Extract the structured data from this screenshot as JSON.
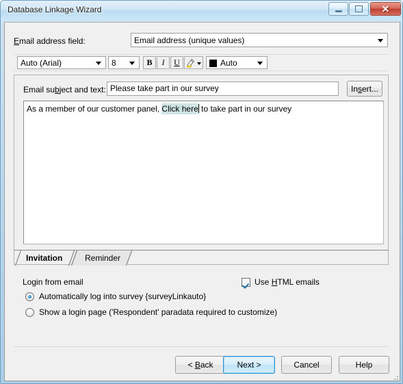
{
  "window": {
    "title": "Database Linkage Wizard",
    "buttons": {
      "minimize": "minimize",
      "maximize": "restore",
      "close": "✕"
    }
  },
  "email_field_row": {
    "label_pre": "E",
    "label_post": "mail address field:",
    "label_full": "Email address field:",
    "combo_value": "Email address (unique values)"
  },
  "toolbar": {
    "font_value": "Auto (Arial)",
    "size_value": "8",
    "bold_label": "B",
    "italic_label": "I",
    "underline_label": "U",
    "highlight_label": "highlight",
    "color_value": "Auto",
    "color_swatch": "#000000"
  },
  "subject_row": {
    "label_pre": "Email su",
    "label_accel": "b",
    "label_post": "ject and text:",
    "label_full": "Email subject and text:",
    "input_value": "Please take part in our survey",
    "insert_pre": "In",
    "insert_accel": "s",
    "insert_post": "ert...",
    "insert_label": "Insert..."
  },
  "body_editor": {
    "text_before": "As a member of our customer panel, ",
    "text_selected": "Click here",
    "text_after": " to take part in our survey",
    "full_text": "As a member of our customer panel, Click here to take part in our survey",
    "selection_color": "#cfe5e5"
  },
  "tabs": [
    {
      "label": "Invitation",
      "active": true
    },
    {
      "label": "Reminder",
      "active": false
    }
  ],
  "login_group": {
    "label": "Login from email",
    "options": [
      {
        "label": "Automatically log into survey {surveyLinkauto}",
        "selected": true
      },
      {
        "label": "Show a login page ('Respondent' paradata required to customize)",
        "selected": false
      }
    ]
  },
  "html_checkbox": {
    "pre": "Use ",
    "accel": "H",
    "post": "TML emails",
    "label": "Use HTML emails",
    "checked": true
  },
  "footer": {
    "back_pre": "< ",
    "back_accel": "B",
    "back_post": "ack",
    "back_label": "< Back",
    "next_label": "Next >",
    "cancel_label": "Cancel",
    "help_label": "Help"
  }
}
